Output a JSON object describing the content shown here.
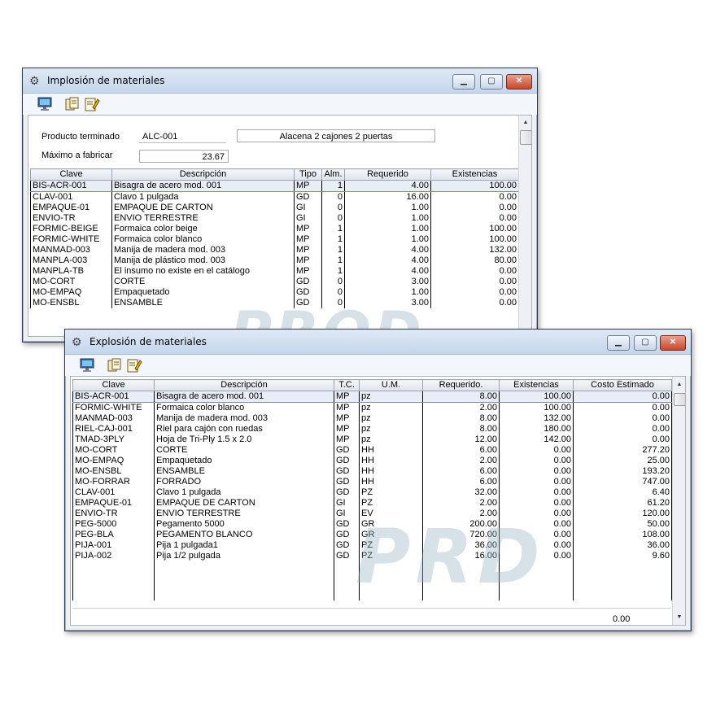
{
  "implosion": {
    "title": "Implosión de materiales",
    "product_label": "Producto terminado",
    "product_code": "ALC-001",
    "product_desc": "Alacena 2 cajones 2 puertas",
    "max_label": "Máximo a fabricar",
    "max_value": "23.67",
    "columns": [
      "Clave",
      "Descripción",
      "Tipo",
      "Alm.",
      "Requerido",
      "Existencias"
    ],
    "rows": [
      [
        "BIS-ACR-001",
        "Bisagra de acero mod. 001",
        "MP",
        "1",
        "4.00",
        "100.00"
      ],
      [
        "CLAV-001",
        "Clavo 1 pulgada",
        "GD",
        "0",
        "16.00",
        "0.00"
      ],
      [
        "EMPAQUE-01",
        "EMPAQUE DE CARTON",
        "GI",
        "0",
        "1.00",
        "0.00"
      ],
      [
        "ENVIO-TR",
        "ENVIO TERRESTRE",
        "GI",
        "0",
        "1.00",
        "0.00"
      ],
      [
        "FORMIC-BEIGE",
        "Formaica color beige",
        "MP",
        "1",
        "1.00",
        "100.00"
      ],
      [
        "FORMIC-WHITE",
        "Formaica color blanco",
        "MP",
        "1",
        "1.00",
        "100.00"
      ],
      [
        "MANMAD-003",
        "Manija de madera mod. 003",
        "MP",
        "1",
        "4.00",
        "132.00"
      ],
      [
        "MANPLA-003",
        "Manija de plástico mod. 003",
        "MP",
        "1",
        "4.00",
        "80.00"
      ],
      [
        "MANPLA-TB",
        "El insumo no existe en el catálogo",
        "MP",
        "1",
        "4.00",
        "0.00"
      ],
      [
        "MO-CORT",
        "CORTE",
        "GD",
        "0",
        "3.00",
        "0.00"
      ],
      [
        "MO-EMPAQ",
        "Empaquetado",
        "GD",
        "0",
        "1.00",
        "0.00"
      ],
      [
        "MO-ENSBL",
        "ENSAMBLE",
        "GD",
        "0",
        "3.00",
        "0.00"
      ]
    ],
    "watermark": "PROD"
  },
  "explosion": {
    "title": "Explosión de materiales",
    "columns": [
      "Clave",
      "Descripción",
      "T.C.",
      "U.M.",
      "Requerido.",
      "Existencias",
      "Costo Estimado"
    ],
    "rows": [
      [
        "BIS-ACR-001",
        "Bisagra de acero mod. 001",
        "MP",
        "pz",
        "8.00",
        "100.00",
        "0.00"
      ],
      [
        "FORMIC-WHITE",
        "Formaica color blanco",
        "MP",
        "pz",
        "2.00",
        "100.00",
        "0.00"
      ],
      [
        "MANMAD-003",
        "Manija de madera mod. 003",
        "MP",
        "pz",
        "8.00",
        "132.00",
        "0.00"
      ],
      [
        "RIEL-CAJ-001",
        "Riel para cajón con ruedas",
        "MP",
        "pz",
        "8.00",
        "180.00",
        "0.00"
      ],
      [
        "TMAD-3PLY",
        "Hoja de Tri-Ply 1.5 x 2.0",
        "MP",
        "pz",
        "12.00",
        "142.00",
        "0.00"
      ],
      [
        "MO-CORT",
        "CORTE",
        "GD",
        "HH",
        "6.00",
        "0.00",
        "277.20"
      ],
      [
        "MO-EMPAQ",
        "Empaquetado",
        "GD",
        "HH",
        "2.00",
        "0.00",
        "25.00"
      ],
      [
        "MO-ENSBL",
        "ENSAMBLE",
        "GD",
        "HH",
        "6.00",
        "0.00",
        "193.20"
      ],
      [
        "MO-FORRAR",
        "FORRADO",
        "GD",
        "HH",
        "6.00",
        "0.00",
        "747.00"
      ],
      [
        "CLAV-001",
        "Clavo 1 pulgada",
        "GD",
        "PZ",
        "32.00",
        "0.00",
        "6.40"
      ],
      [
        "EMPAQUE-01",
        "EMPAQUE DE CARTON",
        "GI",
        "PZ",
        "2.00",
        "0.00",
        "61.20"
      ],
      [
        "ENVIO-TR",
        "ENVIO TERRESTRE",
        "GI",
        "EV",
        "2.00",
        "0.00",
        "120.00"
      ],
      [
        "PEG-5000",
        "Pegamento 5000",
        "GD",
        "GR",
        "200.00",
        "0.00",
        "50.00"
      ],
      [
        "PEG-BLA",
        "PEGAMENTO BLANCO",
        "GD",
        "GR",
        "720.00",
        "0.00",
        "108.00"
      ],
      [
        "PIJA-001",
        "Pija 1 pulgada1",
        "GD",
        "PZ",
        "36.00",
        "0.00",
        "36.00"
      ],
      [
        "PIJA-002",
        "Pija 1/2 pulgada",
        "GD",
        "PZ",
        "16.00",
        "0.00",
        "9.60"
      ]
    ],
    "total": "0.00",
    "watermark": "PRD"
  },
  "window_buttons": {
    "minimize": "▁",
    "maximize": "▢",
    "close": "✕"
  },
  "icons": [
    "gear-icon",
    "monitor-icon",
    "copy-icon",
    "edit-icon"
  ]
}
